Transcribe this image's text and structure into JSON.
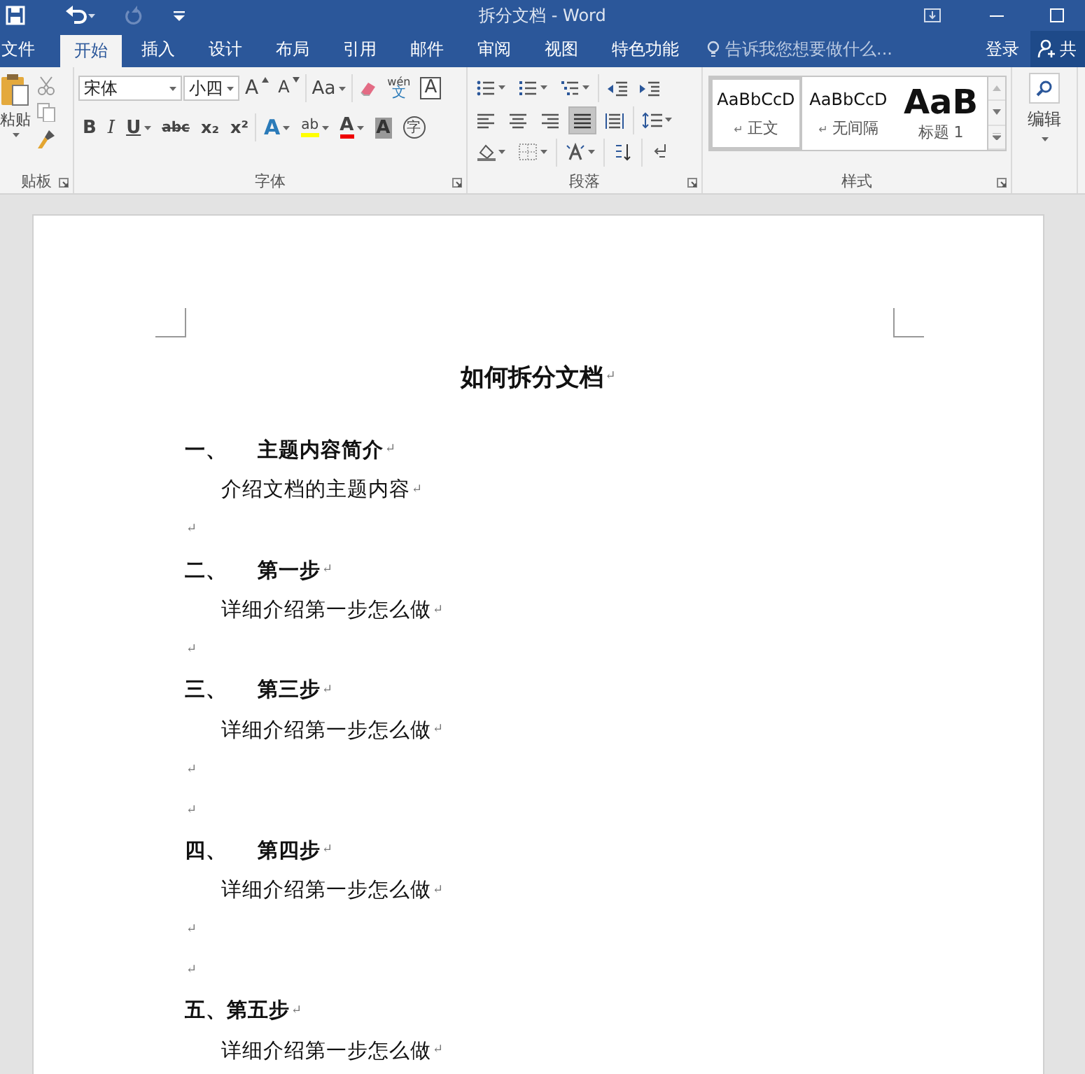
{
  "title_bar": {
    "title": "拆分文档 - Word"
  },
  "tabs": [
    {
      "label": "文件",
      "selected": false
    },
    {
      "label": "开始",
      "selected": true
    },
    {
      "label": "插入",
      "selected": false
    },
    {
      "label": "设计",
      "selected": false
    },
    {
      "label": "布局",
      "selected": false
    },
    {
      "label": "引用",
      "selected": false
    },
    {
      "label": "邮件",
      "selected": false
    },
    {
      "label": "审阅",
      "selected": false
    },
    {
      "label": "视图",
      "selected": false
    },
    {
      "label": "特色功能",
      "selected": false
    }
  ],
  "tell_me": {
    "placeholder": "告诉我您想要做什么..."
  },
  "sign_in": "登录",
  "share": "共",
  "ribbon": {
    "clipboard": {
      "paste": "粘贴",
      "label": "贴板"
    },
    "font": {
      "font_name": "宋体",
      "font_size": "小四",
      "label": "字体",
      "row1": [
        {
          "kind": "grow",
          "label": "A"
        },
        {
          "kind": "shrink",
          "label": "A"
        },
        {
          "kind": "case",
          "label": "Aa"
        },
        {
          "kind": "clear"
        },
        {
          "kind": "phonetic",
          "ruby": "wén",
          "label": "文"
        },
        {
          "kind": "boxed",
          "label": "A"
        }
      ],
      "row2": [
        {
          "kind": "bold",
          "label": "B"
        },
        {
          "kind": "italic",
          "label": "I"
        },
        {
          "kind": "underline",
          "label": "U"
        },
        {
          "kind": "strike",
          "label": "abc"
        },
        {
          "kind": "sub",
          "label": "x₂"
        },
        {
          "kind": "sup",
          "label": "x²"
        },
        {
          "kind": "effect",
          "label": "A"
        },
        {
          "kind": "highlight",
          "label": "ab"
        },
        {
          "kind": "color",
          "label": "A"
        },
        {
          "kind": "shade",
          "label": "A"
        },
        {
          "kind": "enclose",
          "label": "字"
        }
      ]
    },
    "paragraph": {
      "label": "段落",
      "align": [
        {
          "kind": "left",
          "selected": false
        },
        {
          "kind": "center",
          "selected": false
        },
        {
          "kind": "right",
          "selected": false
        },
        {
          "kind": "justify",
          "selected": true
        },
        {
          "kind": "distribute",
          "selected": false
        }
      ]
    },
    "styles": {
      "label": "样式",
      "items": [
        {
          "sample": "AaBbCcD",
          "name": "正文",
          "mark": "↵",
          "selected": true
        },
        {
          "sample": "AaBbCcD",
          "name": "无间隔",
          "mark": "↵",
          "selected": false
        },
        {
          "sample": "AaB",
          "name": "标题 1",
          "selected": false
        }
      ]
    },
    "editing": {
      "label": "编辑"
    }
  },
  "document": {
    "paragraphs": [
      {
        "kind": "title",
        "text": "如何拆分文档",
        "mark": "↵"
      },
      {
        "kind": "heading",
        "number": "一、",
        "text": "主题内容简介",
        "mark": "↵"
      },
      {
        "kind": "body",
        "text": "介绍文档的主题内容",
        "mark": "↵"
      },
      {
        "kind": "empty",
        "mark": "↵"
      },
      {
        "kind": "heading",
        "number": "二、",
        "text": "第一步",
        "mark": "↵"
      },
      {
        "kind": "body",
        "text": "详细介绍第一步怎么做",
        "mark": "↵"
      },
      {
        "kind": "empty",
        "mark": "↵"
      },
      {
        "kind": "heading",
        "number": "三、",
        "text": "第三步 ",
        "mark": "↵"
      },
      {
        "kind": "body",
        "text": "详细介绍第一步怎么做",
        "mark": "↵"
      },
      {
        "kind": "empty",
        "mark": "↵"
      },
      {
        "kind": "empty",
        "mark": "↵"
      },
      {
        "kind": "heading",
        "number": "四、",
        "text": "第四步",
        "mark": "↵"
      },
      {
        "kind": "body",
        "text": "详细介绍第一步怎么做",
        "mark": "↵"
      },
      {
        "kind": "empty",
        "mark": "↵"
      },
      {
        "kind": "empty",
        "mark": "↵"
      },
      {
        "kind": "heading",
        "text": "五、第五步",
        "mark": "↵"
      },
      {
        "kind": "body",
        "text": "详细介绍第一步怎么做",
        "mark": "↵"
      }
    ]
  }
}
